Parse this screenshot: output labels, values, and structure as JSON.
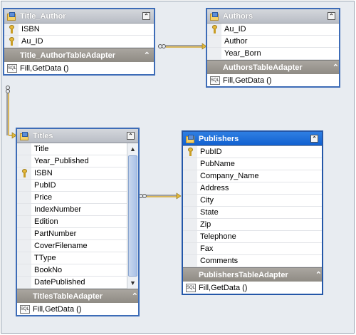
{
  "tables": {
    "title_author": {
      "name": "Title_Author",
      "fields": [
        {
          "label": "ISBN",
          "key": true
        },
        {
          "label": "Au_ID",
          "key": true
        }
      ],
      "adapter": "Title_AuthorTableAdapter",
      "methods": "Fill,GetData ()"
    },
    "authors": {
      "name": "Authors",
      "fields": [
        {
          "label": "Au_ID",
          "key": true
        },
        {
          "label": "Author",
          "key": false
        },
        {
          "label": "Year_Born",
          "key": false
        }
      ],
      "adapter": "AuthorsTableAdapter",
      "methods": "Fill,GetData ()"
    },
    "titles": {
      "name": "Titles",
      "fields": [
        {
          "label": "Title",
          "key": false
        },
        {
          "label": "Year_Published",
          "key": false
        },
        {
          "label": "ISBN",
          "key": true
        },
        {
          "label": "PubID",
          "key": false
        },
        {
          "label": "Price",
          "key": false
        },
        {
          "label": "IndexNumber",
          "key": false
        },
        {
          "label": "Edition",
          "key": false
        },
        {
          "label": "PartNumber",
          "key": false
        },
        {
          "label": "CoverFilename",
          "key": false
        },
        {
          "label": "TType",
          "key": false
        },
        {
          "label": "BookNo",
          "key": false
        },
        {
          "label": "DatePublished",
          "key": false
        }
      ],
      "adapter": "TitlesTableAdapter",
      "methods": "Fill,GetData ()"
    },
    "publishers": {
      "name": "Publishers",
      "fields": [
        {
          "label": "PubID",
          "key": true
        },
        {
          "label": "PubName",
          "key": false
        },
        {
          "label": "Company_Name",
          "key": false
        },
        {
          "label": "Address",
          "key": false
        },
        {
          "label": "City",
          "key": false
        },
        {
          "label": "State",
          "key": false
        },
        {
          "label": "Zip",
          "key": false
        },
        {
          "label": "Telephone",
          "key": false
        },
        {
          "label": "Fax",
          "key": false
        },
        {
          "label": "Comments",
          "key": false
        }
      ],
      "adapter": "PublishersTableAdapter",
      "methods": "Fill,GetData ()"
    }
  },
  "icons": {
    "collapse": "double-chevron-up-icon",
    "key": "primary-key-icon",
    "table": "table-icon",
    "sql": "sql-method-icon"
  },
  "colors": {
    "table_border": "#3d6cb7",
    "selected_header": "#1160d0",
    "adapter_header": "#8f8b84",
    "relation_line": "#d4a52a"
  }
}
